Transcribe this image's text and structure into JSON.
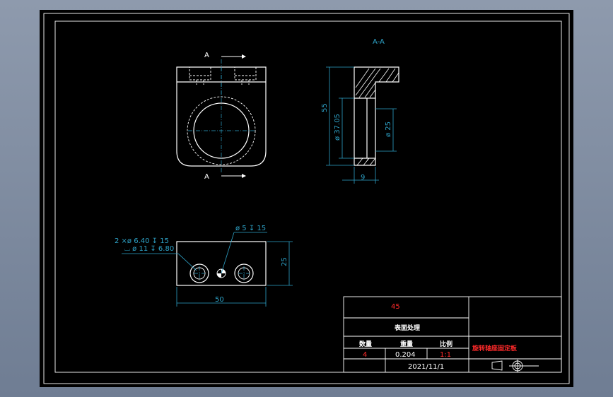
{
  "drawing": {
    "section_label": "A-A",
    "cut_label_top": "A",
    "cut_label_bottom": "A",
    "dims": {
      "height_55": "55",
      "dia_37": "ø 37.05",
      "dia_25": "ø 25",
      "width_9": "9",
      "hole_spec_line1": "2 ×ø 6.40 ↧ 15",
      "hole_spec_line2": "⌴ ø 11 ↧ 6.80",
      "pin_spec": "ø 5 ↧ 15",
      "height_25": "25",
      "width_50": "50"
    }
  },
  "title_block": {
    "material": "45",
    "surface_label": "表面处理",
    "qty_label": "数量",
    "weight_label": "重量",
    "scale_label": "比例",
    "qty_value": "4",
    "weight_value": "0.204",
    "scale_value": "1:1",
    "part_name": "旋转轴座固定板",
    "date": "2021/11/1"
  },
  "colors": {
    "background": "#000000",
    "outline": "#ffffff",
    "dimension": "#2ea3c8",
    "emphasis": "#ff2a2a",
    "window": "#7b879b"
  }
}
